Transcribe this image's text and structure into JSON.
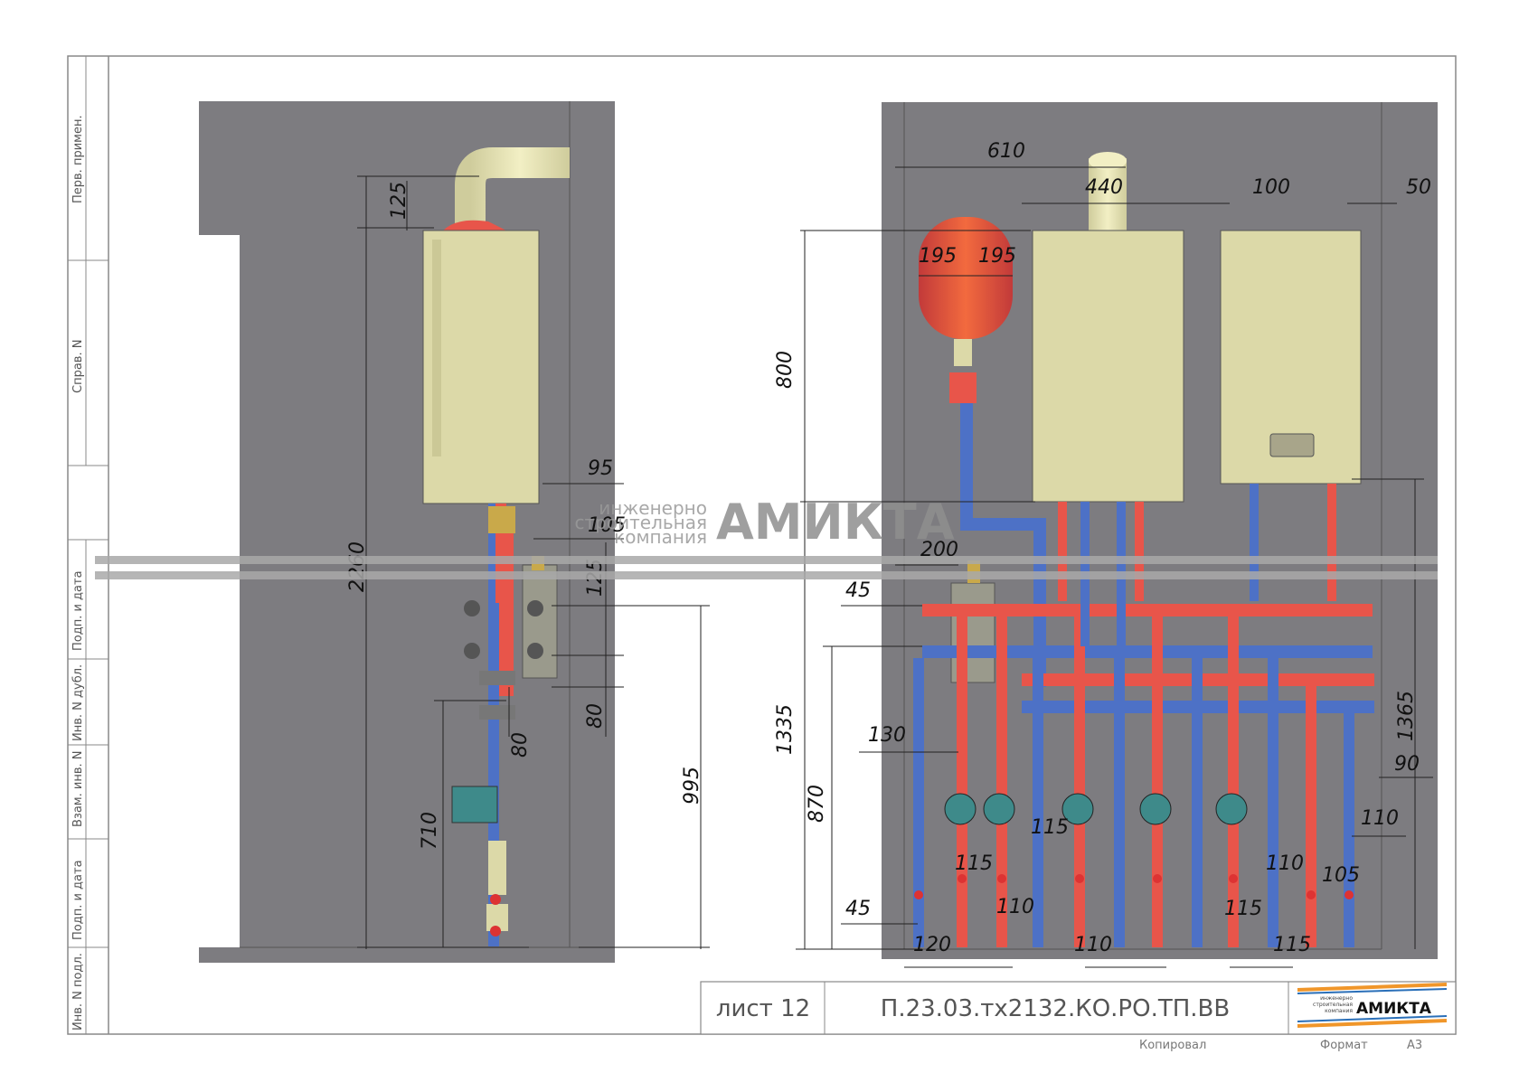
{
  "side_stamp": {
    "perv_primen": "Перв. примен.",
    "sprav_n": "Справ. N",
    "podp_i_data_1": "Подп. и дата",
    "inv_n_dubl": "Инв. N дубл.",
    "vzam_inv_n": "Взам. инв. N",
    "podp_i_data_2": "Подп. и дата",
    "inv_n_podl": "Инв. N подл."
  },
  "watermark": {
    "line1": "инженерно",
    "line2": "строительная",
    "line3": "компания",
    "brand": "АМИКТА"
  },
  "left_view": {
    "dims": [
      "125",
      "2260",
      "95",
      "105",
      "125",
      "80",
      "80",
      "710",
      "995"
    ]
  },
  "right_view": {
    "dims": [
      "610",
      "440",
      "100",
      "50",
      "195",
      "195",
      "800",
      "200",
      "45",
      "1335",
      "130",
      "870",
      "115",
      "115",
      "110",
      "110",
      "45",
      "120",
      "110",
      "115",
      "115",
      "1365",
      "90",
      "110",
      "105"
    ]
  },
  "title_block": {
    "sheet": "лист 12",
    "code": "П.23.03.тх2132.КО.РО.ТП.ВВ",
    "logo_small_1": "инженерно",
    "logo_small_2": "строительная",
    "logo_small_3": "компания",
    "logo_brand": "АМИКТА",
    "copied": "Копировал",
    "format_label": "Формат",
    "format_value": "А3"
  },
  "colors": {
    "wall": "#7d7c80",
    "boiler": "#dcd9a8",
    "hot_pipe": "#e8554a",
    "cold_pipe": "#4d71c6",
    "tank": "#ec5a3c",
    "logo_orange": "#f0962a",
    "logo_blue": "#2a6fb8"
  }
}
